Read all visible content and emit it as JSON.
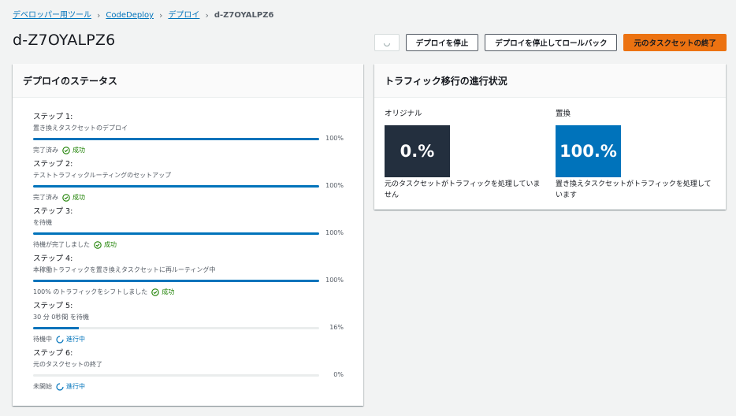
{
  "breadcrumb": {
    "items": [
      "デベロッパー用ツール",
      "CodeDeploy",
      "デプロイ"
    ],
    "current": "d-Z7OYALPZ6"
  },
  "page": {
    "title": "d-Z7OYALPZ6"
  },
  "actions": {
    "refresh_icon": "refresh-icon",
    "stop_label": "デプロイを停止",
    "stop_rollback_label": "デプロイを停止してロールバック",
    "terminate_label": "元のタスクセットの終了"
  },
  "status_panel": {
    "title": "デプロイのステータス",
    "steps": [
      {
        "title": "ステップ 1:",
        "desc": "置き換えタスクセットのデプロイ",
        "progress": 100,
        "pct_label": "100%",
        "state_text": "完了済み",
        "badge": "成功",
        "badge_type": "ok"
      },
      {
        "title": "ステップ 2:",
        "desc": "テストトラフィックルーティングのセットアップ",
        "progress": 100,
        "pct_label": "100%",
        "state_text": "完了済み",
        "badge": "成功",
        "badge_type": "ok"
      },
      {
        "title": "ステップ 3:",
        "desc": "を待機",
        "progress": 100,
        "pct_label": "100%",
        "state_text": "待機が完了しました",
        "badge": "成功",
        "badge_type": "ok"
      },
      {
        "title": "ステップ 4:",
        "desc": "本稼働トラフィックを置き換えタスクセットに再ルーティング中",
        "progress": 100,
        "pct_label": "100%",
        "state_text": "100% のトラフィックをシフトしました",
        "badge": "成功",
        "badge_type": "ok"
      },
      {
        "title": "ステップ 5:",
        "desc": "30 分 0秒間 を待機",
        "progress": 16,
        "pct_label": "16%",
        "state_text": "待機中",
        "badge": "進行中",
        "badge_type": "prog"
      },
      {
        "title": "ステップ 6:",
        "desc": "元のタスクセットの終了",
        "progress": 0,
        "pct_label": "0%",
        "state_text": "未開始",
        "badge": "進行中",
        "badge_type": "prog"
      }
    ]
  },
  "traffic_panel": {
    "title": "トラフィック移行の進行状況",
    "original": {
      "label": "オリジナル",
      "value": "0.%",
      "note": "元のタスクセットがトラフィックを処理していません",
      "color": "#232f3e"
    },
    "replacement": {
      "label": "置換",
      "value": "100.%",
      "note": "置き換えタスクセットがトラフィックを処理しています",
      "color": "#0073bb"
    }
  },
  "colors": {
    "accent": "#0073bb",
    "primary_button": "#ec7211",
    "success": "#1d8102"
  }
}
